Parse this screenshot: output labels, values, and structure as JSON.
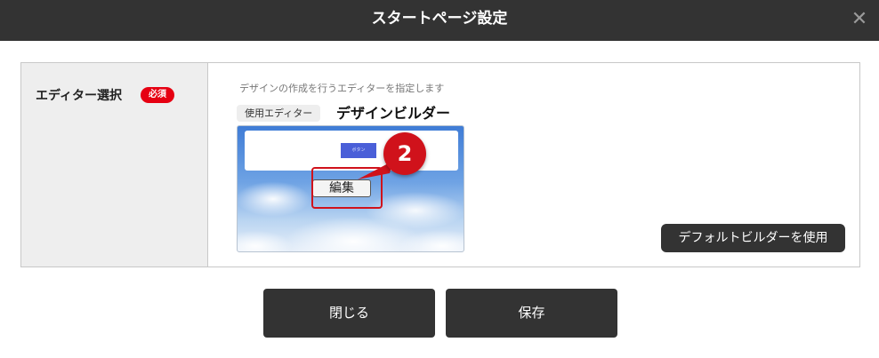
{
  "dialog": {
    "title": "スタートページ設定",
    "close_icon": "close-icon"
  },
  "form": {
    "field_label": "エディター選択",
    "required_badge": "必須",
    "description": "デザインの作成を行うエディターを指定します",
    "editor_label": "使用エディター",
    "editor_value": "デザインビルダー",
    "preview": {
      "button_text": "ボタン",
      "edit_button": "編集"
    },
    "step_marker": "2",
    "default_builder_button": "デフォルトビルダーを使用"
  },
  "footer": {
    "close_label": "閉じる",
    "save_label": "保存"
  },
  "colors": {
    "titlebar": "#333333",
    "required": "#e60012",
    "marker": "#d0121b"
  }
}
